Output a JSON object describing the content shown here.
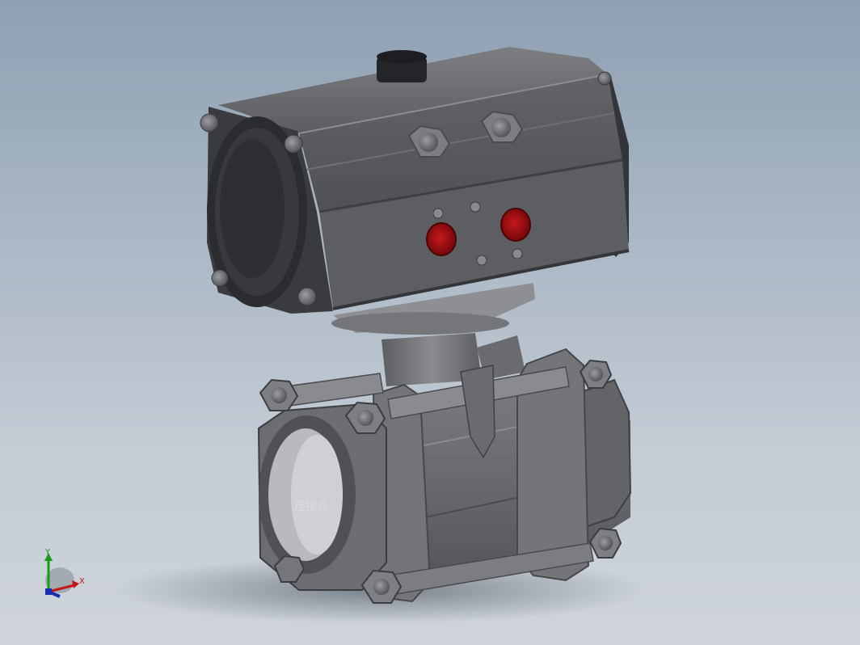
{
  "viewport": {
    "background_top": "#8ea0b3",
    "background_bottom": "#cfd4da"
  },
  "model": {
    "description_icon": "pneumatic-ball-valve-model",
    "actuator_color": "#58595c",
    "actuator_dark": "#2f3033",
    "indicator_port_color": "#9a0f12",
    "valve_body_color": "#6f7073"
  },
  "annotation": {
    "connection_point_label": "连接点"
  },
  "triad": {
    "x_label": "X",
    "y_label": "Y",
    "x_color": "#c01818",
    "y_color": "#1a9a1a",
    "z_color": "#1a2fb0"
  }
}
